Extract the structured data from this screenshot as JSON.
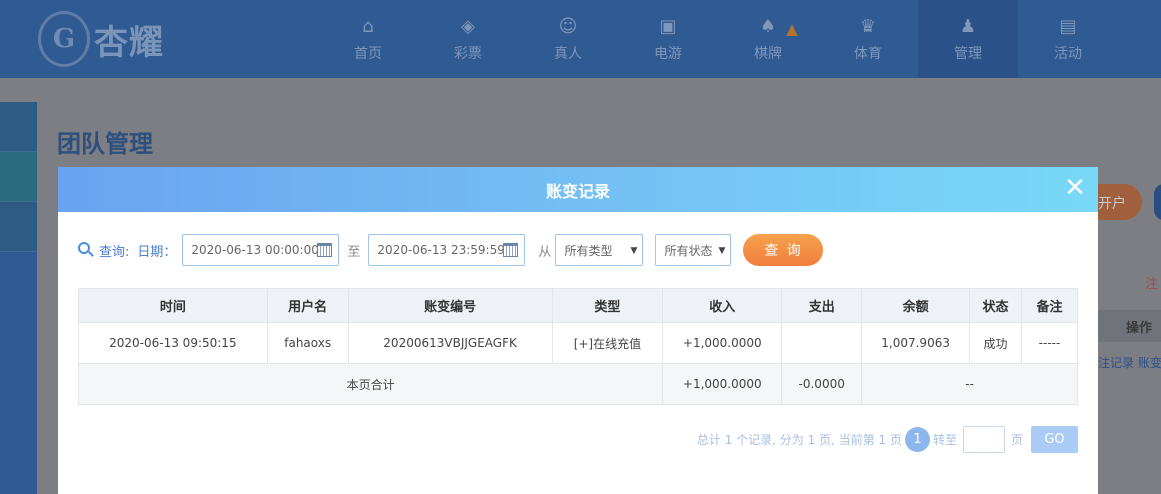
{
  "header": {
    "logo_text": "杏耀",
    "nav": [
      {
        "label": "首页",
        "icon": "home-icon",
        "glyph": "⌂"
      },
      {
        "label": "彩票",
        "icon": "lottery-icon",
        "glyph": "◈"
      },
      {
        "label": "真人",
        "icon": "live-dealer-icon",
        "glyph": "☺"
      },
      {
        "label": "电游",
        "icon": "slot-game-icon",
        "glyph": "▣"
      },
      {
        "label": "棋牌",
        "icon": "cards-icon",
        "glyph": "♠"
      },
      {
        "label": "体育",
        "icon": "trophy-icon",
        "glyph": "♛"
      },
      {
        "label": "管理",
        "icon": "users-icon",
        "glyph": "♟"
      },
      {
        "label": "活动",
        "icon": "gift-icon",
        "glyph": "▤"
      }
    ],
    "active_index": 6
  },
  "page": {
    "title": "团队管理",
    "bg_button": "开户",
    "bg_red_text": "注",
    "bg_op_header": "操作",
    "bg_link": "注记录 账变"
  },
  "modal": {
    "title": "账变记录",
    "close": "✕",
    "query": {
      "label": "查询:",
      "date_label": "日期：",
      "start": "2020-06-13 00:00:00",
      "to": "至",
      "end": "2020-06-13 23:59:59",
      "from": "从",
      "type_select": "所有类型",
      "status_select": "所有状态",
      "button": "查 询"
    },
    "table": {
      "columns": [
        "时间",
        "用户名",
        "账变编号",
        "类型",
        "收入",
        "支出",
        "余额",
        "状态",
        "备注"
      ],
      "rows": [
        {
          "time": "2020-06-13 09:50:15",
          "user": "fahaoxs",
          "serial": "20200613VBJJGEAGFK",
          "type": "[+]在线充值",
          "income": "+1,000.0000",
          "expense": "",
          "balance": "1,007.9063",
          "status": "成功",
          "note": "-----"
        }
      ],
      "total": {
        "label": "本页合计",
        "income": "+1,000.0000",
        "expense": "-0.0000",
        "balance": "--"
      }
    },
    "pager": {
      "summary": "总计 1 个记录, 分为 1 页, 当前第 1 页",
      "current": "1",
      "goto_label": "转至",
      "page_unit": "页",
      "go": "GO"
    }
  }
}
